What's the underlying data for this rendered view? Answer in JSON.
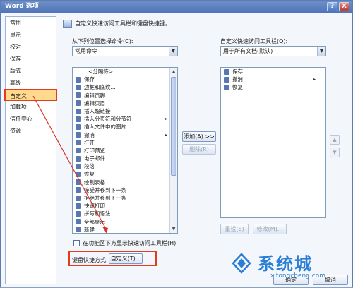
{
  "window": {
    "title": "Word 选项",
    "help_label": "?",
    "close_label": "X"
  },
  "nav": {
    "items": [
      {
        "label": "常用"
      },
      {
        "label": "显示"
      },
      {
        "label": "校对"
      },
      {
        "label": "保存"
      },
      {
        "label": "版式"
      },
      {
        "label": "高级"
      },
      {
        "label": "自定义",
        "selected": true
      },
      {
        "label": "加载项"
      },
      {
        "label": "信任中心"
      },
      {
        "label": "资源"
      }
    ]
  },
  "main": {
    "header": "自定义快速访问工具栏和键盘快捷键。",
    "left_label": "从下列位置选择命令(C):",
    "left_select": "常用命令",
    "right_label": "自定义快速访问工具栏(Q):",
    "right_select": "用于所有文档(默认)",
    "commands": [
      {
        "label": "<分隔符>",
        "icon": "separator",
        "submenu": false
      },
      {
        "label": "保存",
        "icon": "save-icon",
        "submenu": false
      },
      {
        "label": "边框和底纹...",
        "icon": "border-icon",
        "submenu": false
      },
      {
        "label": "编辑页脚",
        "icon": "footer-icon",
        "submenu": false
      },
      {
        "label": "编辑页眉",
        "icon": "header-icon",
        "submenu": false
      },
      {
        "label": "插入超链接",
        "icon": "hyperlink-icon",
        "submenu": false
      },
      {
        "label": "插入分页符和分节符",
        "icon": "page-break-icon",
        "submenu": true
      },
      {
        "label": "插入文件中的图片",
        "icon": "picture-icon",
        "submenu": false
      },
      {
        "label": "撤消",
        "icon": "undo-icon",
        "submenu": true
      },
      {
        "label": "打开",
        "icon": "open-icon",
        "submenu": false
      },
      {
        "label": "打印预览",
        "icon": "print-preview-icon",
        "submenu": false
      },
      {
        "label": "电子邮件",
        "icon": "email-icon",
        "submenu": false
      },
      {
        "label": "段落",
        "icon": "paragraph-icon",
        "submenu": false
      },
      {
        "label": "恢复",
        "icon": "redo-icon",
        "submenu": false
      },
      {
        "label": "绘制表格",
        "icon": "draw-table-icon",
        "submenu": false
      },
      {
        "label": "接受并移到下一条",
        "icon": "accept-icon",
        "submenu": false
      },
      {
        "label": "拒绝并移到下一条",
        "icon": "reject-icon",
        "submenu": false
      },
      {
        "label": "快速打印",
        "icon": "quick-print-icon",
        "submenu": false
      },
      {
        "label": "拼写和语法",
        "icon": "spelling-icon",
        "submenu": false
      },
      {
        "label": "全部显示",
        "icon": "show-all-icon",
        "submenu": false
      },
      {
        "label": "新建",
        "icon": "new-icon",
        "submenu": false
      }
    ],
    "toolbar_items": [
      {
        "label": "保存",
        "icon": "save-icon",
        "submenu": false
      },
      {
        "label": "撤消",
        "icon": "undo-icon",
        "submenu": true
      },
      {
        "label": "恢复",
        "icon": "redo-icon",
        "submenu": false
      }
    ],
    "add_button": "添加(A) >>",
    "remove_button": "删除(R)",
    "reset_button": "重设(E)",
    "modify_button": "修改(M)...",
    "checkbox_label": "在功能区下方显示快速访问工具栏(H)",
    "keyboard_label": "键盘快捷方式:",
    "keyboard_button": "自定义(T)...",
    "ok_button": "确定",
    "cancel_button": "取消"
  },
  "watermark": {
    "text": "系统城",
    "url": "xitongcheng.com"
  },
  "colors": {
    "accent": "#e33b1f",
    "selection": "#ffd98c",
    "title_bar": "#4f74b8"
  }
}
